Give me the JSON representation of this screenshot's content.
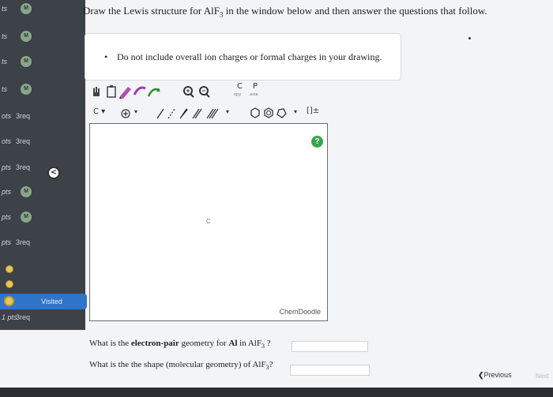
{
  "instruction": {
    "pre": "Draw the Lewis structure for AlF",
    "sub": "3",
    "post": " in the window below and then answer the questions that follow."
  },
  "note": "Do not include overall ion charges or formal charges in your drawing.",
  "sidebar": {
    "items": [
      {
        "pts": "ts",
        "badge": "M"
      },
      {
        "pts": "ts",
        "badge": "M"
      },
      {
        "pts": "ts",
        "badge": "M"
      },
      {
        "pts": "ts",
        "badge": "M"
      },
      {
        "pts": "ots",
        "req": "3req"
      },
      {
        "pts": "ots",
        "req": "3req"
      },
      {
        "pts": "pts",
        "req": "3req"
      },
      {
        "pts": "pts",
        "badge": "M"
      },
      {
        "pts": "pts",
        "badge": "M"
      },
      {
        "pts": "pts",
        "req": "3req"
      },
      {
        "pts": "1 pts",
        "req": "3req"
      }
    ],
    "visited_label": "Visited",
    "collapse_glyph": "<"
  },
  "toolbar": {
    "c_label": "C",
    "p_label": "P",
    "copy_label": "opy",
    "paste_label": "aste",
    "element_select": "C",
    "charge_label": "[]±"
  },
  "canvas": {
    "center_label": "C",
    "brand": "ChemDoodle",
    "help_glyph": "?"
  },
  "questions": [
    {
      "pre": "What is the ",
      "bold": "electron-pair",
      "post": " geometry for ",
      "bold2": "Al",
      "tail": " in AlF",
      "sub": "3",
      "end": " ?"
    },
    {
      "pre": "What is the the shape (molecular geometry) of AlF",
      "sub": "3",
      "end": "?"
    }
  ],
  "nav": {
    "previous": "Previous",
    "next": "Next"
  }
}
